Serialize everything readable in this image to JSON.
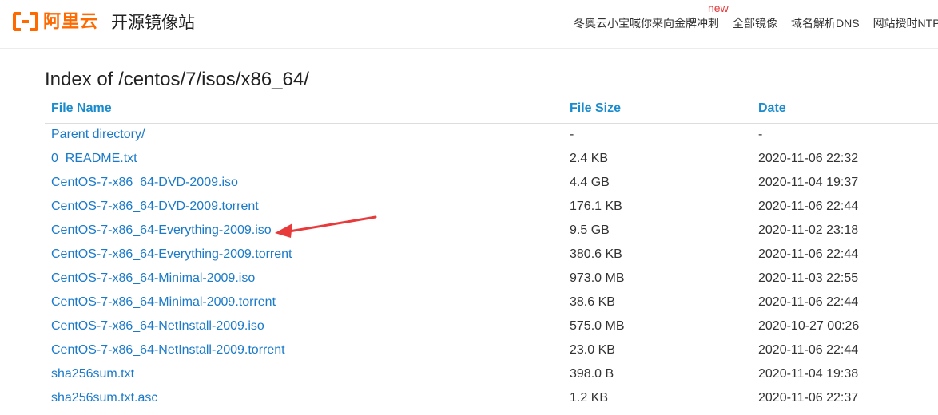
{
  "header": {
    "logo_text": "阿里云",
    "site_title": "开源镜像站",
    "new_badge": "new",
    "brand_color": "#ff6a00",
    "nav": [
      {
        "label": "冬奥云小宝喊你来向金牌冲刺"
      },
      {
        "label": "全部镜像"
      },
      {
        "label": "域名解析DNS"
      },
      {
        "label": "网站授时NTP"
      }
    ]
  },
  "page": {
    "heading": "Index of /centos/7/isos/x86_64/"
  },
  "table": {
    "columns": [
      "File Name",
      "File Size",
      "Date"
    ],
    "rows": [
      {
        "name": "Parent directory/",
        "size": "-",
        "date": "-"
      },
      {
        "name": "0_README.txt",
        "size": "2.4 KB",
        "date": "2020-11-06 22:32"
      },
      {
        "name": "CentOS-7-x86_64-DVD-2009.iso",
        "size": "4.4 GB",
        "date": "2020-11-04 19:37"
      },
      {
        "name": "CentOS-7-x86_64-DVD-2009.torrent",
        "size": "176.1 KB",
        "date": "2020-11-06 22:44"
      },
      {
        "name": "CentOS-7-x86_64-Everything-2009.iso",
        "size": "9.5 GB",
        "date": "2020-11-02 23:18"
      },
      {
        "name": "CentOS-7-x86_64-Everything-2009.torrent",
        "size": "380.6 KB",
        "date": "2020-11-06 22:44"
      },
      {
        "name": "CentOS-7-x86_64-Minimal-2009.iso",
        "size": "973.0 MB",
        "date": "2020-11-03 22:55"
      },
      {
        "name": "CentOS-7-x86_64-Minimal-2009.torrent",
        "size": "38.6 KB",
        "date": "2020-11-06 22:44"
      },
      {
        "name": "CentOS-7-x86_64-NetInstall-2009.iso",
        "size": "575.0 MB",
        "date": "2020-10-27 00:26"
      },
      {
        "name": "CentOS-7-x86_64-NetInstall-2009.torrent",
        "size": "23.0 KB",
        "date": "2020-11-06 22:44"
      },
      {
        "name": "sha256sum.txt",
        "size": "398.0 B",
        "date": "2020-11-04 19:38"
      },
      {
        "name": "sha256sum.txt.asc",
        "size": "1.2 KB",
        "date": "2020-11-06 22:37"
      }
    ]
  },
  "annotation": {
    "color": "#e83a3a"
  }
}
